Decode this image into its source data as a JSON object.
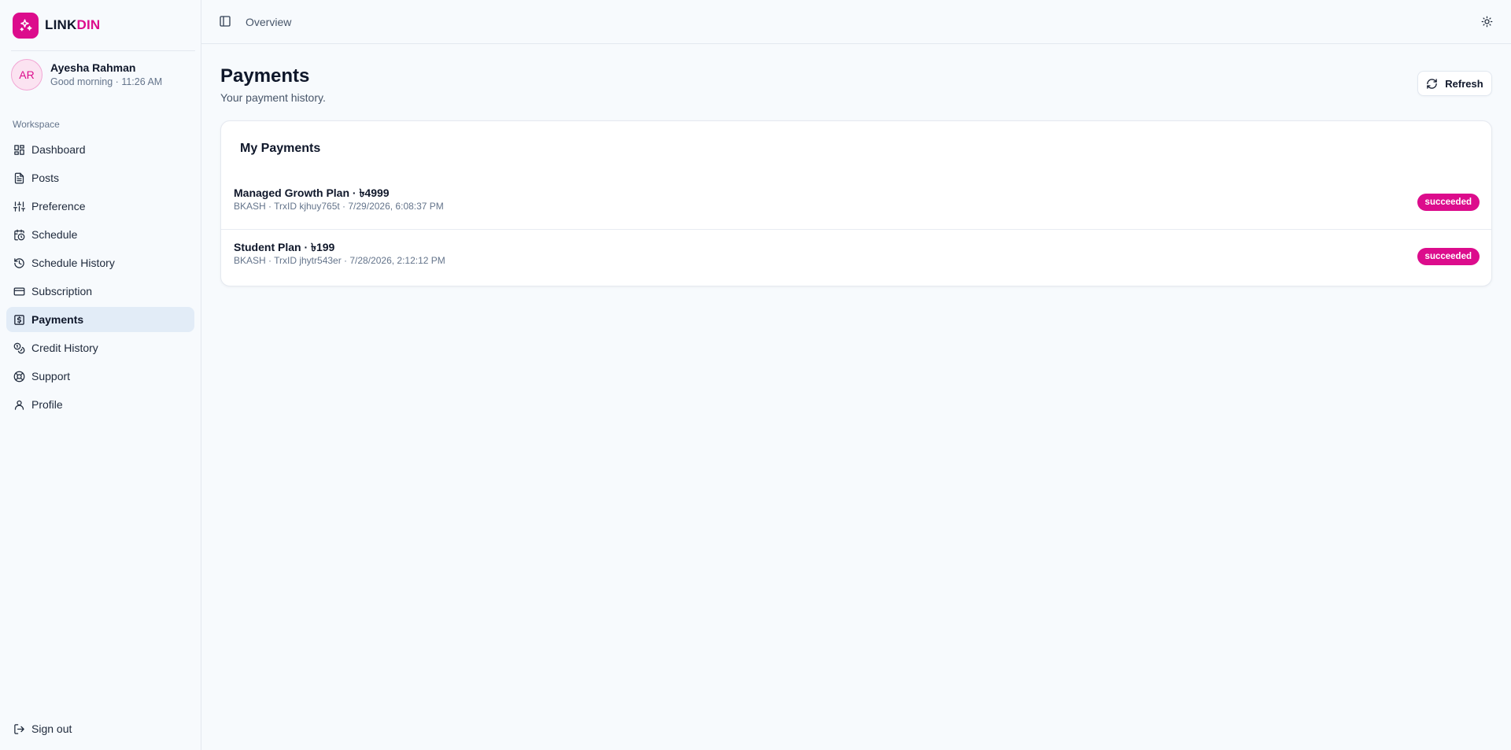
{
  "brand": {
    "name_part1": "LINK",
    "name_part2": "DIN",
    "accent": "#dc0c8c"
  },
  "user": {
    "initials": "AR",
    "name": "Ayesha Rahman",
    "subtitle": "Good morning · 11:26 AM"
  },
  "sidebar": {
    "section_label": "Workspace",
    "items": [
      {
        "label": "Dashboard",
        "icon": "dashboard-icon"
      },
      {
        "label": "Posts",
        "icon": "file-text-icon"
      },
      {
        "label": "Preference",
        "icon": "sliders-icon"
      },
      {
        "label": "Schedule",
        "icon": "calendar-clock-icon"
      },
      {
        "label": "Schedule History",
        "icon": "history-icon"
      },
      {
        "label": "Subscription",
        "icon": "credit-card-icon"
      },
      {
        "label": "Payments",
        "icon": "receipt-icon",
        "active": true
      },
      {
        "label": "Credit History",
        "icon": "coins-icon"
      },
      {
        "label": "Support",
        "icon": "lifebuoy-icon"
      },
      {
        "label": "Profile",
        "icon": "user-icon"
      }
    ],
    "sign_out": "Sign out"
  },
  "topbar": {
    "breadcrumb": "Overview"
  },
  "page": {
    "title": "Payments",
    "subtitle": "Your payment history.",
    "refresh_label": "Refresh"
  },
  "payments": {
    "card_title": "My Payments",
    "rows": [
      {
        "title": "Managed Growth Plan · ৳4999",
        "meta": "BKASH · TrxID kjhuy765t · 7/29/2026, 6:08:37 PM",
        "status": "succeeded"
      },
      {
        "title": "Student Plan · ৳199",
        "meta": "BKASH · TrxID jhytr543er · 7/28/2026, 2:12:12 PM",
        "status": "succeeded"
      }
    ]
  }
}
